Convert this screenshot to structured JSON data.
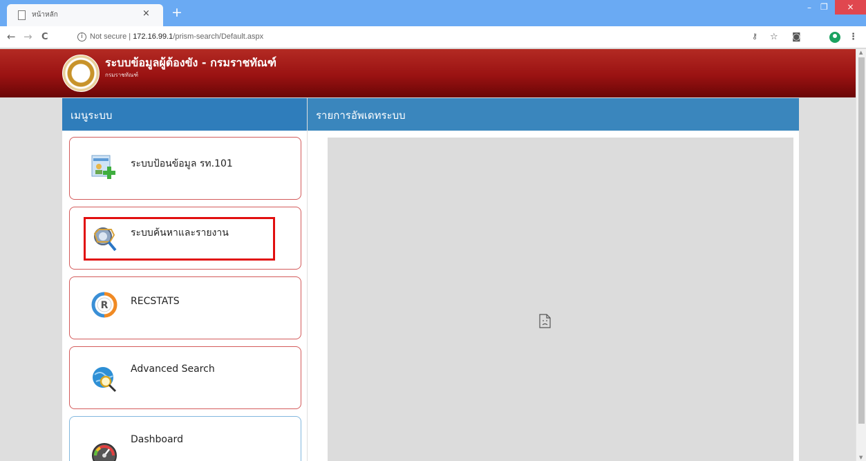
{
  "browser": {
    "tab_title": "หน้าหลัก",
    "tab_close": "×",
    "new_tab": "+",
    "window_buttons": {
      "minimize": "–",
      "maximize": "❐",
      "close": "×"
    },
    "nav": {
      "back": "←",
      "forward": "→",
      "reload": "C"
    },
    "address": {
      "security_label": "Not secure",
      "separator": "|",
      "host": "172.16.99.1",
      "path": "/prism-search/Default.aspx"
    },
    "toolbar_icons": {
      "key": "key-icon",
      "star": "star-icon",
      "camera": "camera-icon",
      "menu": "⋮"
    }
  },
  "header": {
    "title": "ระบบข้อมูลผู้ต้องขัง - กรมราชทัณฑ์",
    "subtitle": "กรมราชทัณฑ์"
  },
  "left_panel": {
    "title": "เมนูระบบ",
    "items": [
      {
        "label": "ระบบป้อนข้อมูล รท.101",
        "icon": "add-user-icon"
      },
      {
        "label": "ระบบค้นหาและรายงาน",
        "icon": "search-report-icon",
        "highlighted": true
      },
      {
        "label": "RECSTATS",
        "icon": "recstats-icon"
      },
      {
        "label": "Advanced Search",
        "icon": "globe-search-icon"
      },
      {
        "label": "Dashboard",
        "icon": "gauge-icon"
      }
    ]
  },
  "right_panel": {
    "title": "รายการอัพเดทระบบ",
    "content_state": "broken-frame-icon"
  },
  "colors": {
    "tabbar": "#6aaaf3",
    "header_red": "#9a1212",
    "panel_blue": "#2f7dbb",
    "card_border": "#d35a5a",
    "highlight": "#e10f0f"
  }
}
